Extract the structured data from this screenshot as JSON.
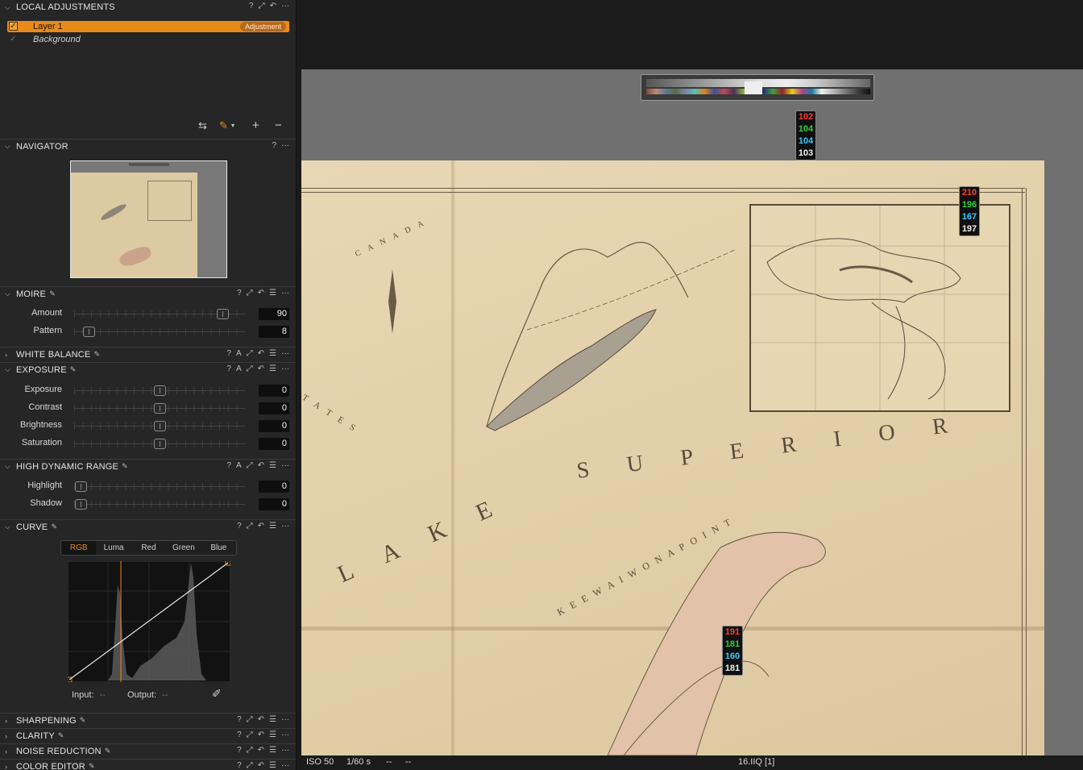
{
  "local_adjustments": {
    "title": "LOCAL ADJUSTMENTS",
    "layers": [
      {
        "name": "Layer 1",
        "badge": "Adjustment",
        "checked": true,
        "selected": true
      },
      {
        "name": "Background",
        "checked": true,
        "selected": false
      }
    ]
  },
  "navigator": {
    "title": "NAVIGATOR"
  },
  "moire": {
    "title": "MOIRE",
    "sliders": [
      {
        "label": "Amount",
        "value": "90",
        "level": 0.9
      },
      {
        "label": "Pattern",
        "value": "8",
        "level": 0.05
      }
    ]
  },
  "white_balance": {
    "title": "WHITE BALANCE"
  },
  "exposure": {
    "title": "EXPOSURE",
    "sliders": [
      {
        "label": "Exposure",
        "value": "0",
        "level": 0.5
      },
      {
        "label": "Contrast",
        "value": "0",
        "level": 0.5
      },
      {
        "label": "Brightness",
        "value": "0",
        "level": 0.5
      },
      {
        "label": "Saturation",
        "value": "0",
        "level": 0.5
      }
    ]
  },
  "hdr": {
    "title": "HIGH DYNAMIC RANGE",
    "sliders": [
      {
        "label": "Highlight",
        "value": "0",
        "level": 0.0
      },
      {
        "label": "Shadow",
        "value": "0",
        "level": 0.0
      }
    ]
  },
  "curve": {
    "title": "CURVE",
    "tabs": [
      "RGB",
      "Luma",
      "Red",
      "Green",
      "Blue"
    ],
    "active_tab": "RGB",
    "input_label": "Input:",
    "input_value": "--",
    "output_label": "Output:",
    "output_value": "--"
  },
  "collapsed_panels": [
    "SHARPENING",
    "CLARITY",
    "NOISE REDUCTION",
    "COLOR EDITOR"
  ],
  "picker_readouts": [
    {
      "r": "102",
      "g": "104",
      "b": "104",
      "l": "103"
    },
    {
      "r": "210",
      "g": "196",
      "b": "167",
      "l": "197"
    },
    {
      "r": "191",
      "g": "181",
      "b": "160",
      "l": "181"
    }
  ],
  "map_text": {
    "lake": "L A K E",
    "superior": "S U P E R I O R",
    "canada": "C A N A D A",
    "keweenaw": "K E E W A I W O N A   P O I N T",
    "states": "T A T E S"
  },
  "status": {
    "iso": "ISO 50",
    "shutter": "1/60 s",
    "aperture": "--",
    "focal": "--",
    "filename": "16.IIQ [1]"
  },
  "colors": {
    "accent": "#e88a1a",
    "panel_bg": "#262626",
    "viewer_bg": "#1b1b1b",
    "canvas_gray": "#707070",
    "paper": "#e3d2ad"
  }
}
